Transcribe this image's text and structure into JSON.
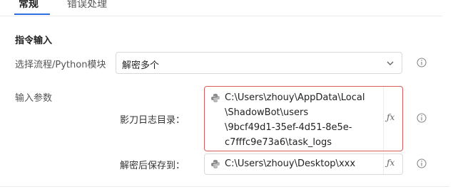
{
  "tabs": [
    {
      "label": "常规"
    },
    {
      "label": "错误处理"
    }
  ],
  "section": {
    "title": "指令输入"
  },
  "flow_select": {
    "label": "选择流程/Python模块",
    "value": "解密多个"
  },
  "params": {
    "label": "输入参数",
    "log_dir": {
      "label": "影刀日志目录：",
      "lines": [
        "C:\\Users\\zhouy\\AppData\\Local",
        "\\ShadowBot\\users",
        "\\9bcf49d1-35ef-4d51-8e5e-",
        "c7fffc9e73a6\\task_logs"
      ]
    },
    "save_to": {
      "label": "解密后保存到：",
      "value": "C:\\Users\\zhouy\\Desktop\\xxx"
    }
  },
  "icons": {
    "fx": "ƒx",
    "info": "info-icon",
    "python": "python-icon",
    "chevron": "chevron-down-icon"
  },
  "colors": {
    "accent": "#2f6de1",
    "error_border": "#d55c5c"
  }
}
